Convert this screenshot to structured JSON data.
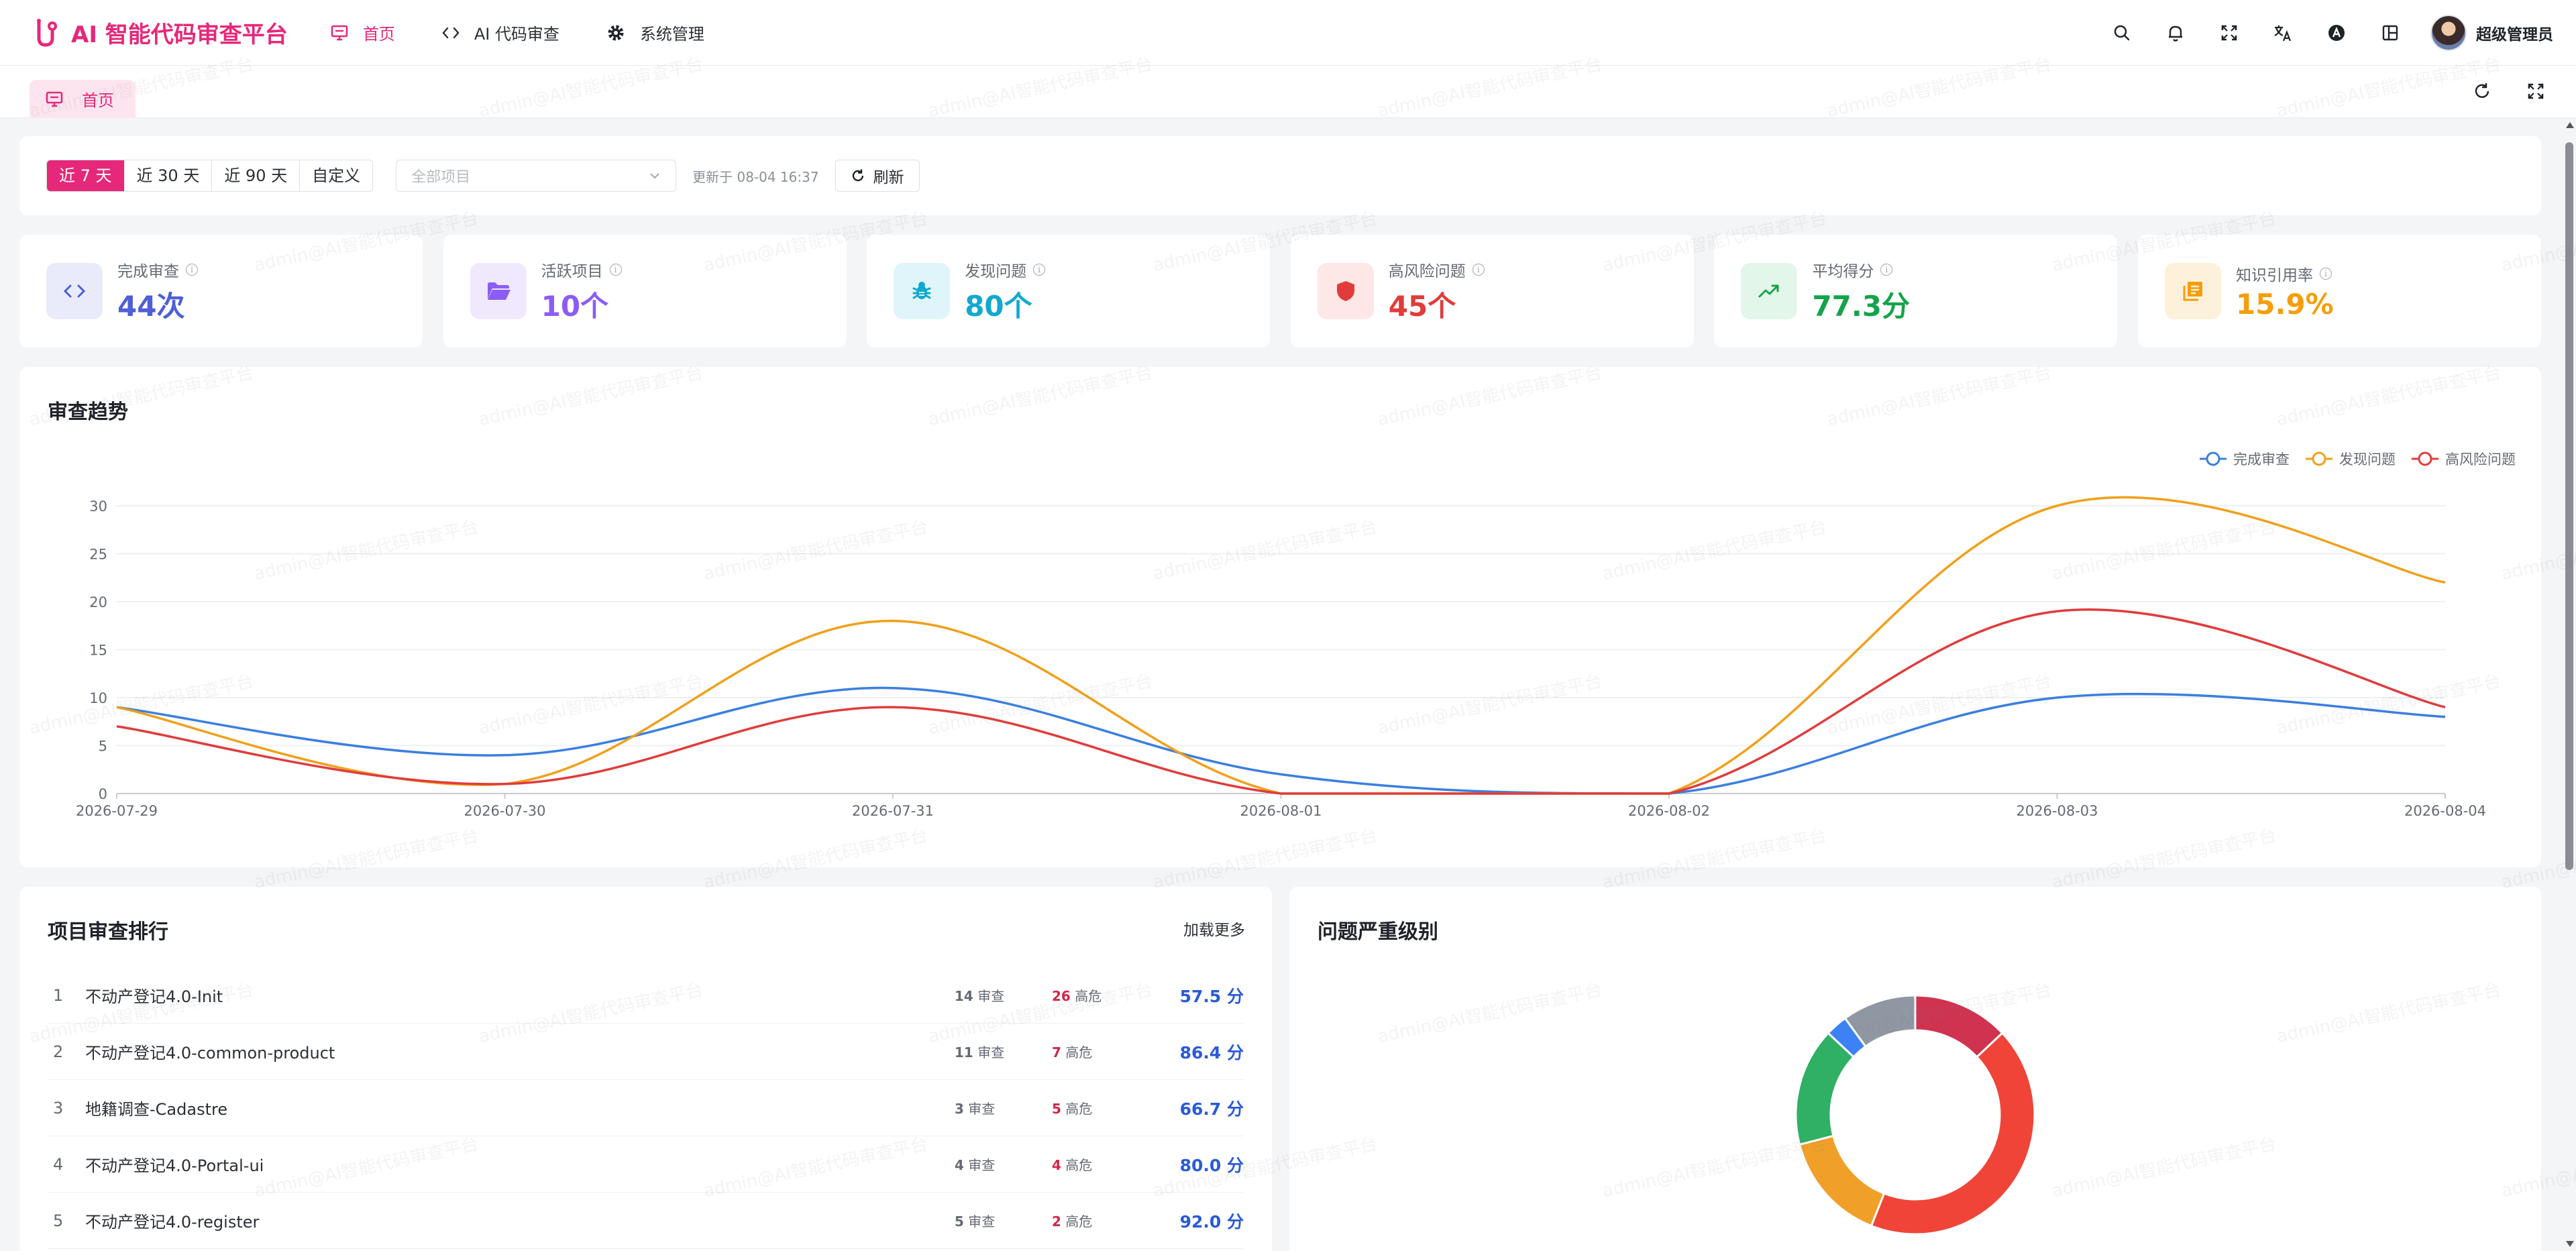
{
  "app": {
    "brand_name": "AI 智能代码审查平台",
    "nav": [
      {
        "label": "首页",
        "active": true
      },
      {
        "label": "AI 代码审查",
        "active": false
      },
      {
        "label": "系统管理",
        "active": false
      }
    ],
    "user_name": "超级管理员",
    "watermark_text": "admin@AI智能代码审查平台"
  },
  "tabs": {
    "home_label": "首页"
  },
  "filters": {
    "ranges": [
      "近 7 天",
      "近 30 天",
      "近 90 天",
      "自定义"
    ],
    "active_range": 0,
    "project_placeholder": "全部项目",
    "updated_text": "更新于 08-04 16:37",
    "refresh_label": "刷新"
  },
  "kpis": [
    {
      "label": "完成审查",
      "value": "44次",
      "color": "#4f5fd6",
      "bg": "#e9ebfb",
      "icon": "code-icon"
    },
    {
      "label": "活跃项目",
      "value": "10个",
      "color": "#8b5cf6",
      "bg": "#f0e9fd",
      "icon": "folder-icon"
    },
    {
      "label": "发现问题",
      "value": "80个",
      "color": "#11a9cf",
      "bg": "#e0f5fa",
      "icon": "bug-icon"
    },
    {
      "label": "高风险问题",
      "value": "45个",
      "color": "#e23b3b",
      "bg": "#fde7e7",
      "icon": "shield-icon"
    },
    {
      "label": "平均得分",
      "value": "77.3分",
      "color": "#16a34a",
      "bg": "#e2f6ea",
      "icon": "trend-up-icon"
    },
    {
      "label": "知识引用率",
      "value": "15.9%",
      "color": "#f59e0b",
      "bg": "#fdf1dc",
      "icon": "books-icon"
    }
  ],
  "trend": {
    "title": "审查趋势"
  },
  "ranking": {
    "title": "项目审查排行",
    "more_label": "加载更多",
    "review_suffix": "审查",
    "high_suffix": "高危",
    "rows": [
      {
        "rank": "1",
        "name": "不动产登记4.0-Init",
        "reviews": "14",
        "high": "26",
        "score": "57.5 分"
      },
      {
        "rank": "2",
        "name": "不动产登记4.0-common-product",
        "reviews": "11",
        "high": "7",
        "score": "86.4 分"
      },
      {
        "rank": "3",
        "name": "地籍调查-Cadastre",
        "reviews": "3",
        "high": "5",
        "score": "66.7 分"
      },
      {
        "rank": "4",
        "name": "不动产登记4.0-Portal-ui",
        "reviews": "4",
        "high": "4",
        "score": "80.0 分"
      },
      {
        "rank": "5",
        "name": "不动产登记4.0-register",
        "reviews": "5",
        "high": "2",
        "score": "92.0 分"
      }
    ]
  },
  "severity": {
    "title": "问题严重级别"
  },
  "chart_data": [
    {
      "type": "line",
      "title": "审查趋势",
      "x": [
        "2026-07-29",
        "2026-07-30",
        "2026-07-31",
        "2026-08-01",
        "2026-08-02",
        "2026-08-03",
        "2026-08-04"
      ],
      "ylim": [
        0,
        30
      ],
      "yticks": [
        0,
        5,
        10,
        15,
        20,
        25,
        30
      ],
      "grid": true,
      "legend": "top-right",
      "series": [
        {
          "name": "完成审查",
          "color": "#3b7fde",
          "values": [
            9,
            4,
            11,
            2,
            0,
            10,
            8
          ]
        },
        {
          "name": "发现问题",
          "color": "#f0a01a",
          "values": [
            9,
            1,
            18,
            0,
            0,
            30,
            22
          ]
        },
        {
          "name": "高风险问题",
          "color": "#e03c3c",
          "values": [
            7,
            1,
            9,
            0,
            0,
            19,
            9
          ]
        }
      ]
    },
    {
      "type": "pie",
      "title": "问题严重级别",
      "donut": true,
      "slices": [
        {
          "color": "#d0334f",
          "value": 13
        },
        {
          "color": "#f04438",
          "value": 43
        },
        {
          "color": "#f0a029",
          "value": 15
        },
        {
          "color": "#2fb065",
          "value": 16
        },
        {
          "color": "#3b82f6",
          "value": 3
        },
        {
          "color": "#8f97a3",
          "value": 10
        }
      ]
    }
  ]
}
